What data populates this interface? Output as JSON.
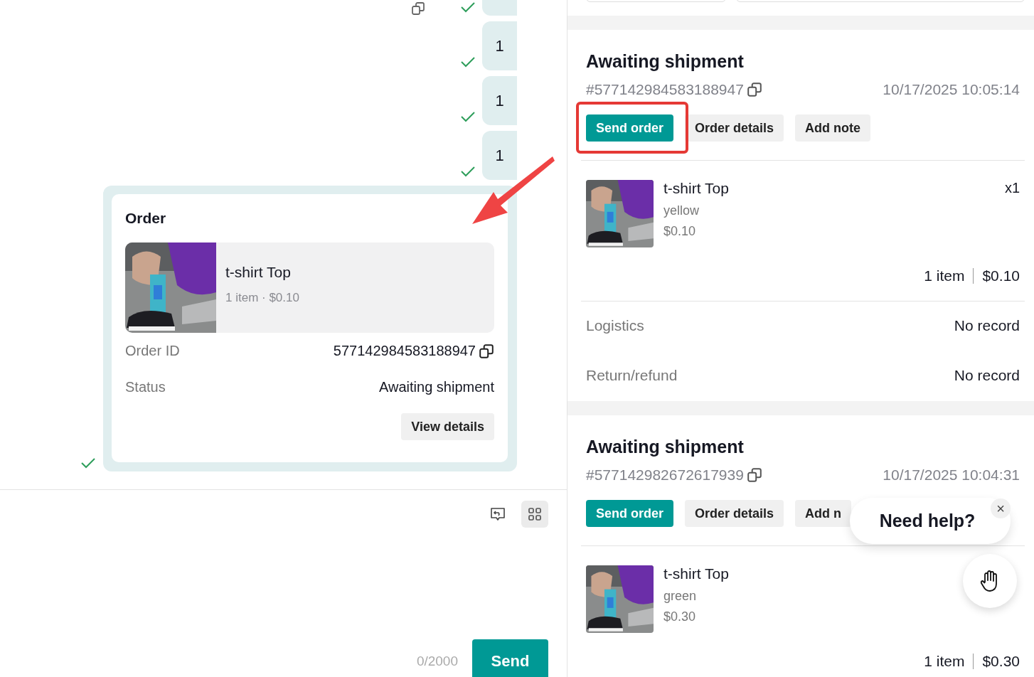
{
  "chat": {
    "messages": [
      {
        "kind": "partial",
        "read": true,
        "copy": true
      },
      {
        "kind": "text",
        "text": "1",
        "read": true,
        "copy": false
      },
      {
        "kind": "text",
        "text": "1",
        "read": true,
        "copy": false
      },
      {
        "kind": "text",
        "text": "1",
        "read": true,
        "copy": false
      }
    ],
    "order_card": {
      "title": "Order",
      "product": {
        "name": "t-shirt Top",
        "summary": "1 item · $0.10"
      },
      "fields": [
        {
          "label": "Order ID",
          "value": "577142984583188947",
          "copy": true
        },
        {
          "label": "Status",
          "value": "Awaiting shipment",
          "copy": false
        }
      ],
      "button": "View details",
      "read": true
    }
  },
  "composer": {
    "tools": [
      {
        "kind": "quick-reply",
        "selected": false
      },
      {
        "kind": "grid",
        "selected": true
      }
    ],
    "counter": "0/2000",
    "send": "Send"
  },
  "orders": [
    {
      "status": "Awaiting shipment",
      "number": "#577142984583188947",
      "date": "10/17/2025 10:05:14",
      "annotated": true,
      "buttons": [
        {
          "label": "Send order",
          "kind": "primary"
        },
        {
          "label": "Order details",
          "kind": "secondary"
        },
        {
          "label": "Add note",
          "kind": "secondary"
        }
      ],
      "items": [
        {
          "name": "t-shirt Top",
          "variant": "yellow",
          "price": "$0.10",
          "qty": "x1"
        }
      ],
      "count": "1 item",
      "total": "$0.10",
      "info": [
        {
          "label": "Logistics",
          "value": "No record"
        },
        {
          "label": "Return/refund",
          "value": "No record"
        }
      ]
    },
    {
      "status": "Awaiting shipment",
      "number": "#577142982672617939",
      "date": "10/17/2025 10:04:31",
      "annotated": false,
      "buttons": [
        {
          "label": "Send order",
          "kind": "primary"
        },
        {
          "label": "Order details",
          "kind": "secondary"
        },
        {
          "label": "Add n",
          "kind": "secondary"
        }
      ],
      "items": [
        {
          "name": "t-shirt Top",
          "variant": "green",
          "price": "$0.30"
        }
      ],
      "count": "1 item",
      "total": "$0.30"
    }
  ],
  "help": {
    "text": "Need help?",
    "close": "×"
  }
}
